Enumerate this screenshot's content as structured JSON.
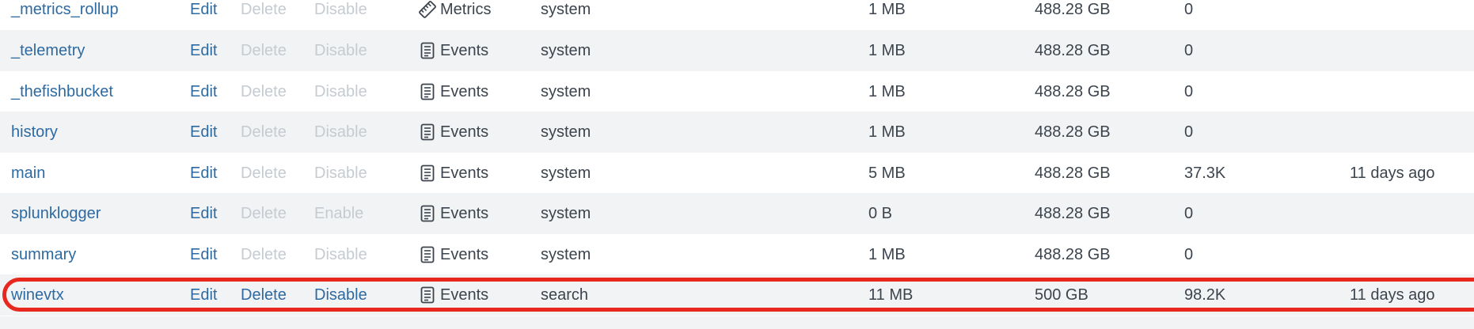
{
  "columns": {
    "edit": "Edit",
    "delete": "Delete"
  },
  "rows": [
    {
      "name": "_metrics_rollup",
      "toggle": "Disable",
      "type_icon": "metrics-icon",
      "type": "Metrics",
      "app": "system",
      "size": "1 MB",
      "max_size": "488.28 GB",
      "event_count": "0",
      "latest": "",
      "delete_enabled": false
    },
    {
      "name": "_telemetry",
      "toggle": "Disable",
      "type_icon": "events-icon",
      "type": "Events",
      "app": "system",
      "size": "1 MB",
      "max_size": "488.28 GB",
      "event_count": "0",
      "latest": "",
      "delete_enabled": false
    },
    {
      "name": "_thefishbucket",
      "toggle": "Disable",
      "type_icon": "events-icon",
      "type": "Events",
      "app": "system",
      "size": "1 MB",
      "max_size": "488.28 GB",
      "event_count": "0",
      "latest": "",
      "delete_enabled": false
    },
    {
      "name": "history",
      "toggle": "Disable",
      "type_icon": "events-icon",
      "type": "Events",
      "app": "system",
      "size": "1 MB",
      "max_size": "488.28 GB",
      "event_count": "0",
      "latest": "",
      "delete_enabled": false
    },
    {
      "name": "main",
      "toggle": "Disable",
      "type_icon": "events-icon",
      "type": "Events",
      "app": "system",
      "size": "5 MB",
      "max_size": "488.28 GB",
      "event_count": "37.3K",
      "latest": "11 days ago",
      "delete_enabled": false
    },
    {
      "name": "splunklogger",
      "toggle": "Enable",
      "type_icon": "events-icon",
      "type": "Events",
      "app": "system",
      "size": "0 B",
      "max_size": "488.28 GB",
      "event_count": "0",
      "latest": "",
      "delete_enabled": false
    },
    {
      "name": "summary",
      "toggle": "Disable",
      "type_icon": "events-icon",
      "type": "Events",
      "app": "system",
      "size": "1 MB",
      "max_size": "488.28 GB",
      "event_count": "0",
      "latest": "",
      "delete_enabled": false
    },
    {
      "name": "winevtx",
      "toggle": "Disable",
      "type_icon": "events-icon",
      "type": "Events",
      "app": "search",
      "size": "11 MB",
      "max_size": "500 GB",
      "event_count": "98.2K",
      "latest": "11 days ago",
      "delete_enabled": true
    }
  ],
  "colors": {
    "link": "#2d6aa2",
    "text": "#3c444d",
    "disabled": "#c5cbd1",
    "row_alt": "#f2f3f4",
    "highlight": "#e8281e"
  }
}
